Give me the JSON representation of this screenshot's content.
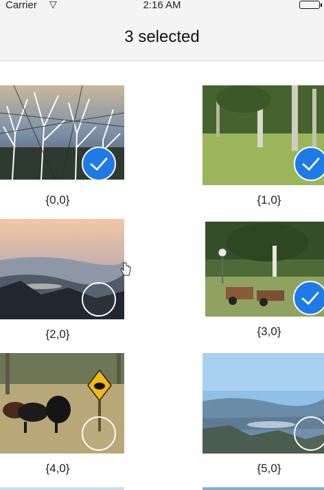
{
  "status": {
    "carrier": "Carrier",
    "time": "2:16 AM"
  },
  "nav": {
    "title": "3 selected"
  },
  "accent": "#1e7be6",
  "cells": [
    {
      "caption": "{0,0}",
      "selected": true
    },
    {
      "caption": "{1,0}",
      "selected": true
    },
    {
      "caption": "{2,0}",
      "selected": false
    },
    {
      "caption": "{3,0}",
      "selected": true
    },
    {
      "caption": "{4,0}",
      "selected": false
    },
    {
      "caption": "{5,0}",
      "selected": false
    }
  ]
}
